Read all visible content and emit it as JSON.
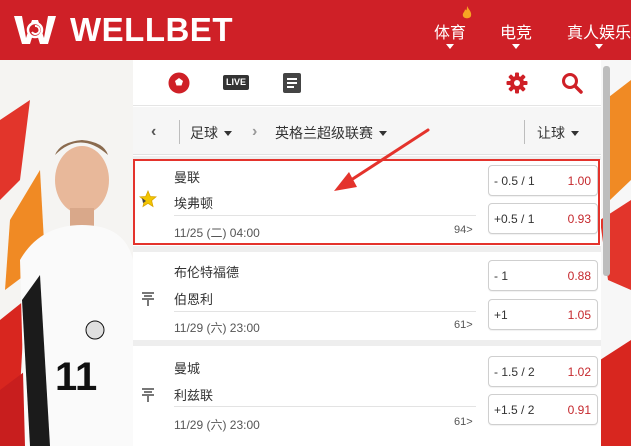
{
  "header": {
    "brand": "WELLBET",
    "nav": [
      {
        "label": "体育"
      },
      {
        "label": "电竞"
      },
      {
        "label": "真人娱乐"
      }
    ]
  },
  "tabs": [
    {
      "icon": "soccer-ball-icon"
    },
    {
      "icon": "live-icon",
      "label": "LIVE"
    },
    {
      "icon": "list-icon"
    }
  ],
  "tools": [
    {
      "icon": "gear-icon"
    },
    {
      "icon": "search-icon"
    }
  ],
  "filters": {
    "sport": "足球",
    "league": "英格兰超级联赛",
    "market": "让球"
  },
  "matches": [
    {
      "home": "曼联",
      "away": "埃弗顿",
      "time": "11/25 (二) 04:00",
      "more": "94>",
      "favorite": true,
      "odds": [
        {
          "line": "- 0.5 / 1",
          "price": "1.00"
        },
        {
          "line": "+0.5 / 1",
          "price": "0.93"
        }
      ]
    },
    {
      "home": "布伦特福德",
      "away": "伯恩利",
      "time": "11/29 (六) 23:00",
      "more": "61>",
      "favorite": false,
      "odds": [
        {
          "line": "- 1",
          "price": "0.88"
        },
        {
          "line": "+1",
          "price": "1.05"
        }
      ]
    },
    {
      "home": "曼城",
      "away": "利兹联",
      "time": "11/29 (六) 23:00",
      "more": "61>",
      "favorite": false,
      "odds": [
        {
          "line": "- 1.5 / 2",
          "price": "1.02"
        },
        {
          "line": "+1.5 / 2",
          "price": "0.91"
        }
      ]
    }
  ],
  "colors": {
    "brand_red": "#cf2027",
    "price_red": "#c5282d",
    "highlight_red": "#e4332c"
  }
}
